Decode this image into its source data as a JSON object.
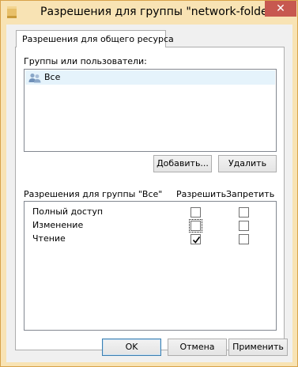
{
  "window": {
    "title": "Разрешения для группы \"network-folder\"",
    "close_glyph": "✕",
    "accent_color": "#f8e3b4"
  },
  "tab": {
    "label": "Разрешения для общего ресурса"
  },
  "groups_section": {
    "label": "Группы или пользователи:",
    "items": [
      {
        "name": "Все",
        "icon": "users-icon",
        "selected": true
      }
    ]
  },
  "group_buttons": {
    "add": "Добавить...",
    "remove": "Удалить"
  },
  "permissions": {
    "header": "Разрешения для группы \"Все\"",
    "allow_header": "Разрешить",
    "deny_header": "Запретить",
    "rows": [
      {
        "name": "Полный доступ",
        "allow": false,
        "deny": false
      },
      {
        "name": "Изменение",
        "allow": false,
        "deny": false,
        "focused": true
      },
      {
        "name": "Чтение",
        "allow": true,
        "deny": false
      }
    ]
  },
  "dialog_buttons": {
    "ok": "OK",
    "cancel": "Отмена",
    "apply": "Применить"
  }
}
